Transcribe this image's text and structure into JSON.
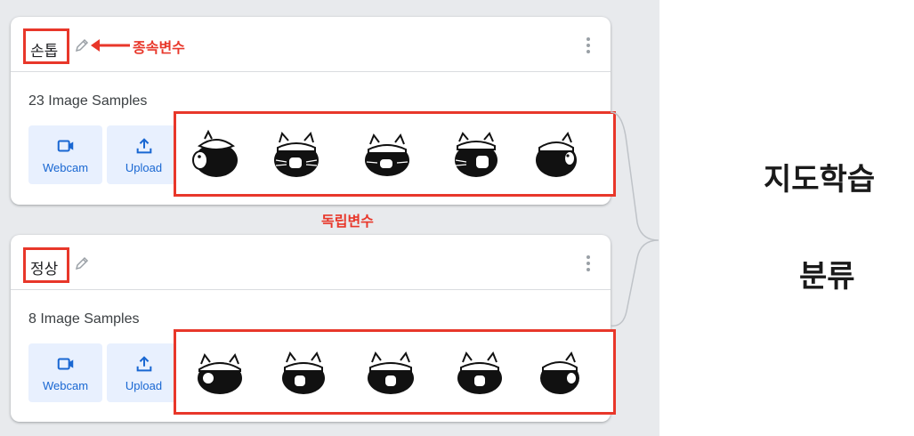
{
  "classes": [
    {
      "name": "손톱",
      "samples_label": "23 Image Samples",
      "webcam_label": "Webcam",
      "upload_label": "Upload",
      "thumbnail_count": 5
    },
    {
      "name": "정상",
      "samples_label": "8 Image Samples",
      "webcam_label": "Webcam",
      "upload_label": "Upload",
      "thumbnail_count": 5
    }
  ],
  "annotations": {
    "dependent_variable": "종속변수",
    "independent_variable": "독립변수",
    "color": "#e8372a"
  },
  "side": {
    "line1": "지도학습",
    "line2": "분류"
  },
  "colors": {
    "accent": "#1967d2",
    "button_bg": "#e8f0fe",
    "panel_bg": "#e8eaed"
  }
}
